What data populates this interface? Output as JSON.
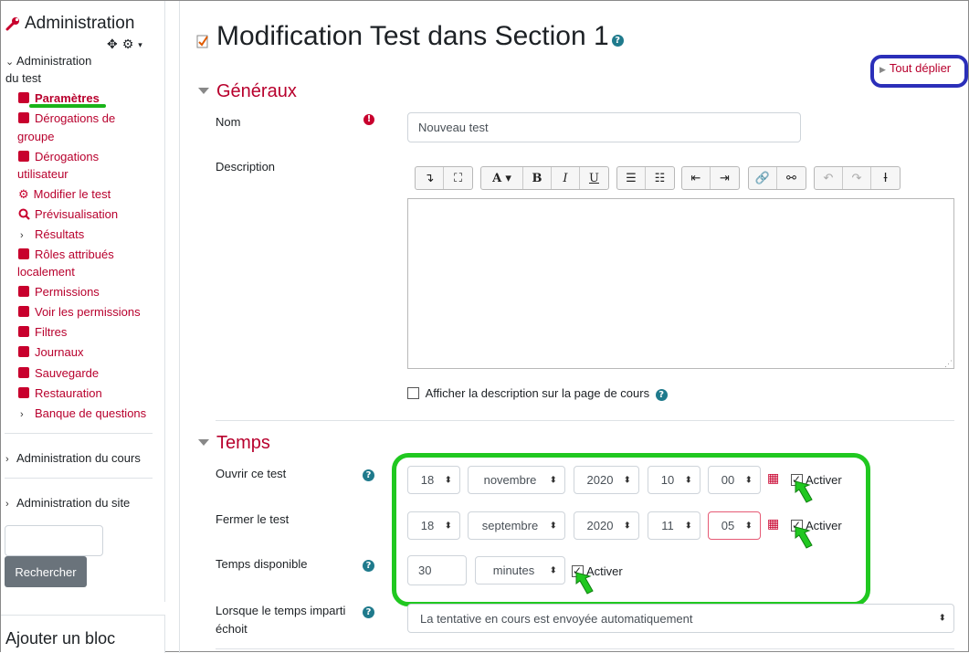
{
  "sidebar": {
    "title": "Administration",
    "section_title_line1": "Administration",
    "section_title_line2": "du test",
    "items": [
      {
        "label": "Paramètres",
        "type": "square"
      },
      {
        "label": "Dérogations de",
        "label2": "groupe",
        "type": "square"
      },
      {
        "label": "Dérogations",
        "label2": "utilisateur",
        "type": "square"
      },
      {
        "label": "Modifier le test",
        "type": "gear"
      },
      {
        "label": "Prévisualisation",
        "type": "zoom"
      },
      {
        "label": "Résultats",
        "type": "chevron"
      },
      {
        "label": "Rôles attribués",
        "label2": "localement",
        "type": "square"
      },
      {
        "label": "Permissions",
        "type": "square"
      },
      {
        "label": "Voir les permissions",
        "type": "square"
      },
      {
        "label": "Filtres",
        "type": "square"
      },
      {
        "label": "Journaux",
        "type": "square"
      },
      {
        "label": "Sauvegarde",
        "type": "square"
      },
      {
        "label": "Restauration",
        "type": "square"
      },
      {
        "label": "Banque de questions",
        "type": "chevron"
      }
    ],
    "course_admin": "Administration du cours",
    "site_admin": "Administration du site",
    "search_button": "Rechercher",
    "add_block": "Ajouter un bloc"
  },
  "page": {
    "title": "Modification Test dans Section 1",
    "expand_all": "Tout déplier"
  },
  "general": {
    "heading": "Généraux",
    "name_label": "Nom",
    "name_value": "Nouveau test",
    "description_label": "Description",
    "show_description_label": "Afficher la description sur la page de cours"
  },
  "timing": {
    "heading": "Temps",
    "open_label": "Ouvrir ce test",
    "open": {
      "day": "18",
      "month": "novembre",
      "year": "2020",
      "hour": "10",
      "minute": "00"
    },
    "close_label": "Fermer le test",
    "close": {
      "day": "18",
      "month": "septembre",
      "year": "2020",
      "hour": "11",
      "minute": "05"
    },
    "enable_label": "Activer",
    "time_limit_label": "Temps disponible",
    "time_limit_value": "30",
    "time_limit_unit": "minutes",
    "when_expires_label_line1": "Lorsque le temps imparti",
    "when_expires_label_line2": "échoit",
    "when_expires_value": "La tentative en cours est envoyée automatiquement"
  },
  "colors": {
    "accent": "#b8002d",
    "highlight_green": "#20c820",
    "highlight_blue": "#2b2fb9"
  }
}
